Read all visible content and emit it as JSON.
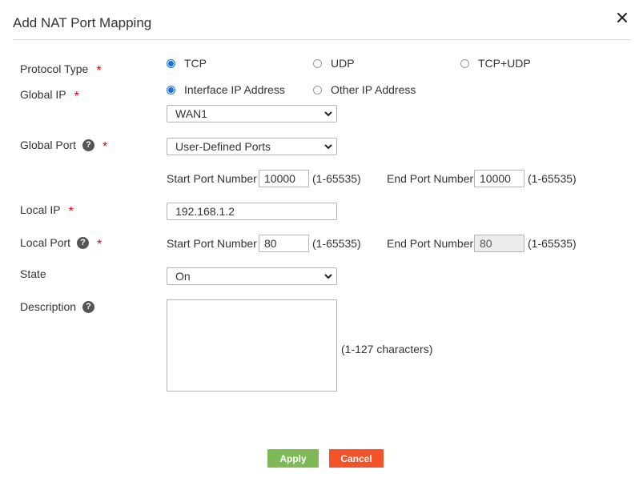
{
  "dialog": {
    "title": "Add NAT Port Mapping",
    "close_icon": "close-icon"
  },
  "protocol": {
    "label": "Protocol Type",
    "required": "*",
    "options": [
      "TCP",
      "UDP",
      "TCP+UDP"
    ],
    "selected": "TCP"
  },
  "global_ip": {
    "label": "Global IP",
    "required": "*",
    "options": [
      "Interface IP Address",
      "Other IP Address"
    ],
    "selected": "Interface IP Address",
    "interface_value": "WAN1"
  },
  "global_port": {
    "label": "Global Port",
    "required": "*",
    "help": "?",
    "type_value": "User-Defined Ports",
    "start_label": "Start Port Number",
    "start_value": "10000",
    "start_range": "(1-65535)",
    "end_label": "End Port Number",
    "end_value": "10000",
    "end_range": "(1-65535)"
  },
  "local_ip": {
    "label": "Local IP",
    "required": "*",
    "value": "192.168.1.2"
  },
  "local_port": {
    "label": "Local Port",
    "required": "*",
    "help": "?",
    "start_label": "Start Port Number",
    "start_value": "80",
    "start_range": "(1-65535)",
    "end_label": "End Port Number",
    "end_value": "80",
    "end_range": "(1-65535)"
  },
  "state": {
    "label": "State",
    "value": "On"
  },
  "description": {
    "label": "Description",
    "help": "?",
    "value": "",
    "hint": "(1-127 characters)"
  },
  "buttons": {
    "apply": "Apply",
    "cancel": "Cancel"
  },
  "colors": {
    "accent": "#1e6fdc",
    "required": "#e60012",
    "apply": "#7dba55",
    "cancel": "#f25328"
  }
}
